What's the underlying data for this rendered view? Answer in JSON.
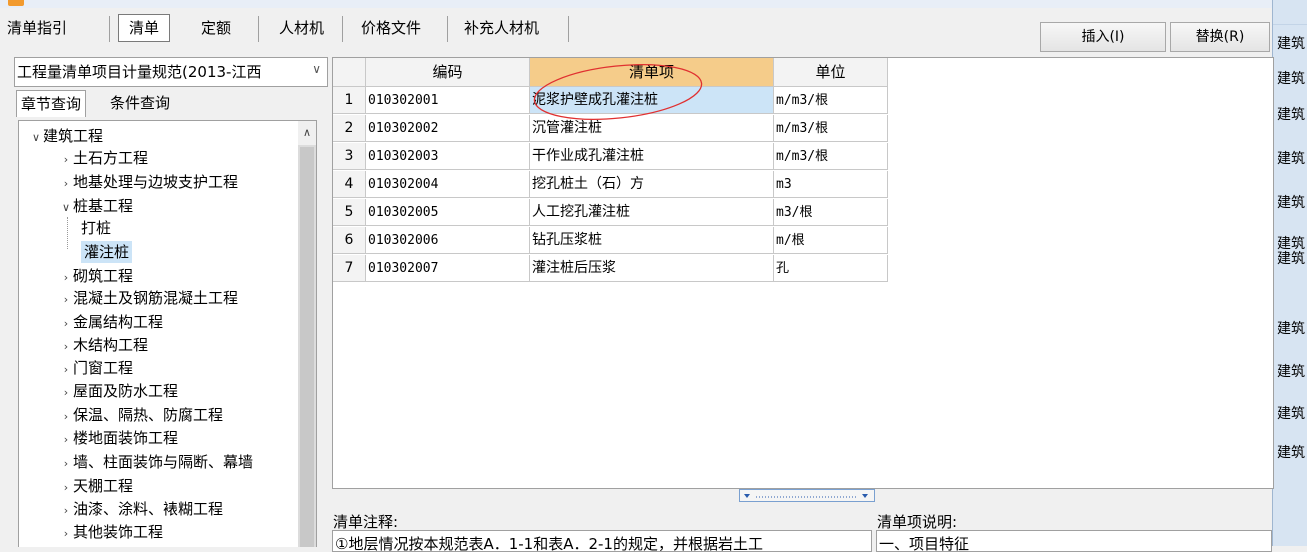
{
  "tabs": [
    {
      "label": "清单指引"
    },
    {
      "label": "清单",
      "active": true
    },
    {
      "label": "定额"
    },
    {
      "label": "人材机"
    },
    {
      "label": "价格文件"
    },
    {
      "label": "补充人材机"
    }
  ],
  "actions": {
    "insert_label": "插入(I)",
    "replace_label": "替换(R)"
  },
  "spec_dropdown": {
    "value": "工程量清单项目计量规范(2013-江西"
  },
  "query_tabs": [
    {
      "label": "章节查询",
      "active": true
    },
    {
      "label": "条件查询"
    }
  ],
  "tree": {
    "root": "建筑工程",
    "items": [
      {
        "label": "土石方工程"
      },
      {
        "label": "地基处理与边坡支护工程"
      },
      {
        "label": "桩基工程",
        "expanded": true,
        "children": [
          {
            "label": "打桩"
          },
          {
            "label": "灌注桩",
            "selected": true
          }
        ]
      },
      {
        "label": "砌筑工程"
      },
      {
        "label": "混凝土及钢筋混凝土工程"
      },
      {
        "label": "金属结构工程"
      },
      {
        "label": "木结构工程"
      },
      {
        "label": "门窗工程"
      },
      {
        "label": "屋面及防水工程"
      },
      {
        "label": "保温、隔热、防腐工程"
      },
      {
        "label": "楼地面装饰工程"
      },
      {
        "label": "墙、柱面装饰与隔断、幕墙"
      },
      {
        "label": "天棚工程"
      },
      {
        "label": "油漆、涂料、裱糊工程"
      },
      {
        "label": "其他装饰工程"
      }
    ]
  },
  "table": {
    "columns": [
      "编码",
      "清单项",
      "单位"
    ],
    "rows": [
      {
        "num": "1",
        "code": "010302001",
        "name": "泥浆护壁成孔灌注桩",
        "unit": "m/m3/根"
      },
      {
        "num": "2",
        "code": "010302002",
        "name": "沉管灌注桩",
        "unit": "m/m3/根"
      },
      {
        "num": "3",
        "code": "010302003",
        "name": "干作业成孔灌注桩",
        "unit": "m/m3/根"
      },
      {
        "num": "4",
        "code": "010302004",
        "name": "挖孔桩土（石）方",
        "unit": "m3"
      },
      {
        "num": "5",
        "code": "010302005",
        "name": "人工挖孔灌注桩",
        "unit": "m3/根"
      },
      {
        "num": "6",
        "code": "010302006",
        "name": "钻孔压浆桩",
        "unit": "m/根"
      },
      {
        "num": "7",
        "code": "010302007",
        "name": "灌注桩后压浆",
        "unit": "孔"
      }
    ]
  },
  "notes": {
    "left_label": "清单注释:",
    "left_text": "①地层情况按本规范表A．1-1和表A．2-1的规定，并根据岩土工",
    "right_label": "清单项说明:",
    "right_text": "一、项目特征"
  },
  "edge_items": [
    "建筑",
    "建筑",
    "建筑",
    "建筑",
    "建筑",
    "建筑",
    "建筑",
    "建筑",
    "建筑",
    "建筑",
    "建筑"
  ],
  "colors": {
    "selection": "#cce4f7",
    "active_header": "#f5cc8a",
    "annotation": "#e03030"
  }
}
